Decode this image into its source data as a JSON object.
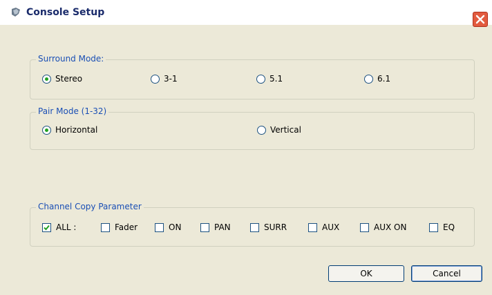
{
  "window": {
    "title": "Console Setup"
  },
  "surround": {
    "legend": "Surround Mode:",
    "options": [
      {
        "label": "Stereo",
        "checked": true
      },
      {
        "label": "3-1",
        "checked": false
      },
      {
        "label": "5.1",
        "checked": false
      },
      {
        "label": "6.1",
        "checked": false
      }
    ]
  },
  "pair": {
    "legend": "Pair Mode (1-32)",
    "options": [
      {
        "label": "Horizontal",
        "checked": true
      },
      {
        "label": "Vertical",
        "checked": false
      }
    ]
  },
  "copy": {
    "legend": "Channel Copy Parameter",
    "options": [
      {
        "label": "ALL :",
        "checked": true
      },
      {
        "label": "Fader",
        "checked": false
      },
      {
        "label": "ON",
        "checked": false
      },
      {
        "label": "PAN",
        "checked": false
      },
      {
        "label": "SURR",
        "checked": false
      },
      {
        "label": "AUX",
        "checked": false
      },
      {
        "label": "AUX ON",
        "checked": false
      },
      {
        "label": "EQ",
        "checked": false
      }
    ]
  },
  "buttons": {
    "ok": "OK",
    "cancel": "Cancel"
  }
}
